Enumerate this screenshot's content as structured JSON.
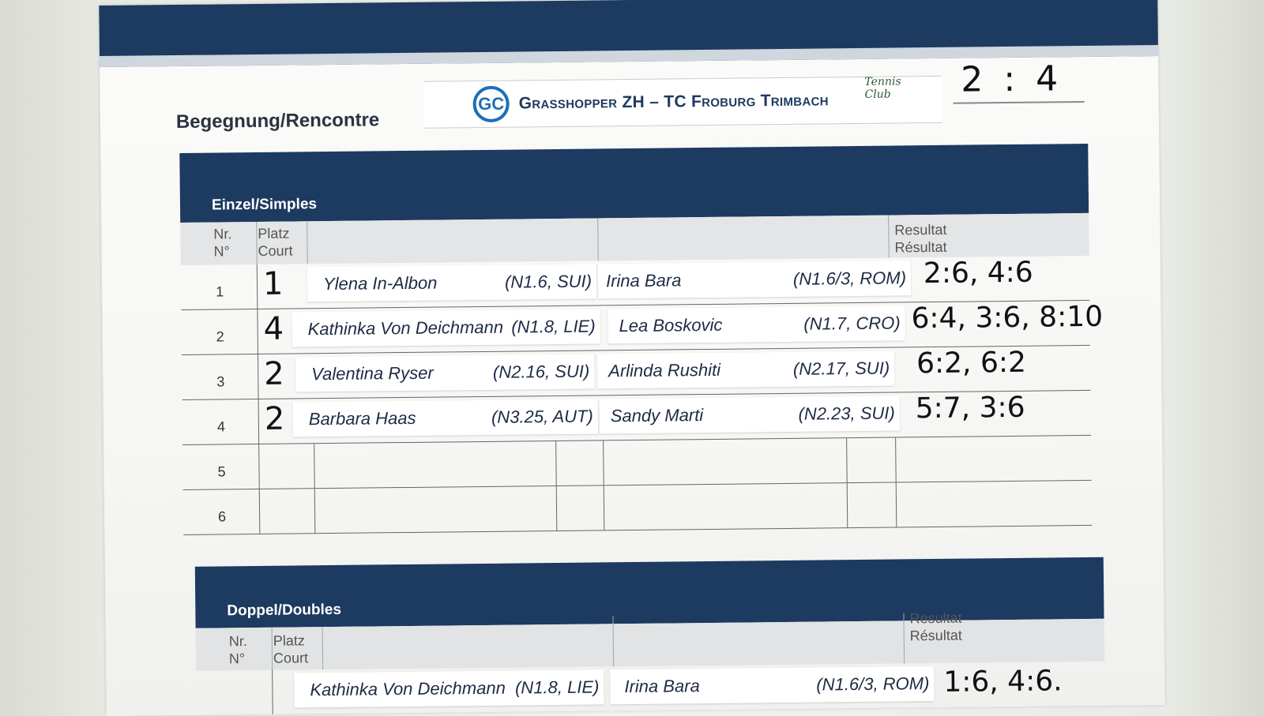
{
  "match": {
    "label": "Begegnung/Rencontre",
    "title": "Grasshopper ZH – TC Froburg Trimbach",
    "home_logo": "GC",
    "away_logo": "Tennis Club",
    "score": "2 : 4"
  },
  "singles": {
    "title": "Einzel/Simples",
    "col_nr": "Nr.\nNo",
    "col_nr_1": "Nr.",
    "col_nr_2": "N°",
    "col_court_1": "Platz",
    "col_court_2": "Court",
    "col_result_1": "Resultat",
    "col_result_2": "Résultat",
    "rows": [
      {
        "nr": "1",
        "court": "1",
        "home": "Ylena In-Albon",
        "home_rank": "(N1.6, SUI)",
        "away": "Irina Bara",
        "away_rank": "(N1.6/3, ROM)",
        "result": "2:6, 4:6"
      },
      {
        "nr": "2",
        "court": "4",
        "home": "Kathinka Von Deichmann",
        "home_rank": "(N1.8, LIE)",
        "away": "Lea Boskovic",
        "away_rank": "(N1.7, CRO)",
        "result": "6:4, 3:6, 8:10"
      },
      {
        "nr": "3",
        "court": "2",
        "home": "Valentina Ryser",
        "home_rank": "(N2.16, SUI)",
        "away": "Arlinda Rushiti",
        "away_rank": "(N2.17, SUI)",
        "result": "6:2, 6:2"
      },
      {
        "nr": "4",
        "court": "2",
        "home": "Barbara Haas",
        "home_rank": "(N3.25, AUT)",
        "away": "Sandy Marti",
        "away_rank": "(N2.23, SUI)",
        "result": "5:7, 3:6"
      },
      {
        "nr": "5"
      },
      {
        "nr": "6"
      }
    ]
  },
  "doubles": {
    "title": "Doppel/Doubles",
    "col_nr_1": "Nr.",
    "col_nr_2": "N°",
    "col_court_1": "Platz",
    "col_court_2": "Court",
    "col_result_1": "Resultat",
    "col_result_2": "Résultat",
    "rows": [
      {
        "home": "Kathinka Von Deichmann",
        "home_rank": "(N1.8, LIE)",
        "away": "Irina Bara",
        "away_rank": "(N1.6/3, ROM)",
        "result": "1:6, 4:6."
      }
    ]
  }
}
